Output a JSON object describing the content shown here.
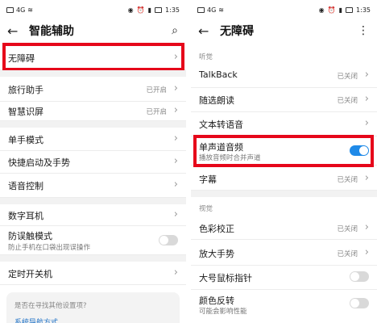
{
  "status": {
    "time": "1:35",
    "signal": "4G"
  },
  "left": {
    "title": "智能辅助",
    "items": [
      {
        "label": "无障碍"
      },
      {
        "label": "旅行助手",
        "value": "已开启"
      },
      {
        "label": "智慧识屏",
        "value": "已开启"
      },
      {
        "label": "单手模式"
      },
      {
        "label": "快捷启动及手势"
      },
      {
        "label": "语音控制"
      },
      {
        "label": "数字耳机"
      },
      {
        "label": "防误触模式",
        "sub": "防止手机在口袋出现误操作",
        "toggle": false
      },
      {
        "label": "定时开关机"
      }
    ],
    "suggest": {
      "question": "是否在寻找其他设置项?",
      "link": "系统导航方式"
    }
  },
  "right": {
    "title": "无障碍",
    "section_hearing": "听觉",
    "section_vision": "视觉",
    "items": [
      {
        "label": "TalkBack",
        "value": "已关闭"
      },
      {
        "label": "随选朗读",
        "value": "已关闭"
      },
      {
        "label": "文本转语音"
      },
      {
        "label": "单声道音频",
        "sub": "播放音频时合并声道",
        "toggle": true
      },
      {
        "label": "字幕",
        "value": "已关闭"
      },
      {
        "label": "色彩校正",
        "value": "已关闭"
      },
      {
        "label": "放大手势",
        "value": "已关闭"
      },
      {
        "label": "大号鼠标指针",
        "toggle": false
      },
      {
        "label": "颜色反转",
        "sub": "可能会影响性能",
        "toggle": false
      }
    ]
  },
  "colors": {
    "highlight": "#e6071a",
    "toggle_on": "#1f8ae8"
  }
}
